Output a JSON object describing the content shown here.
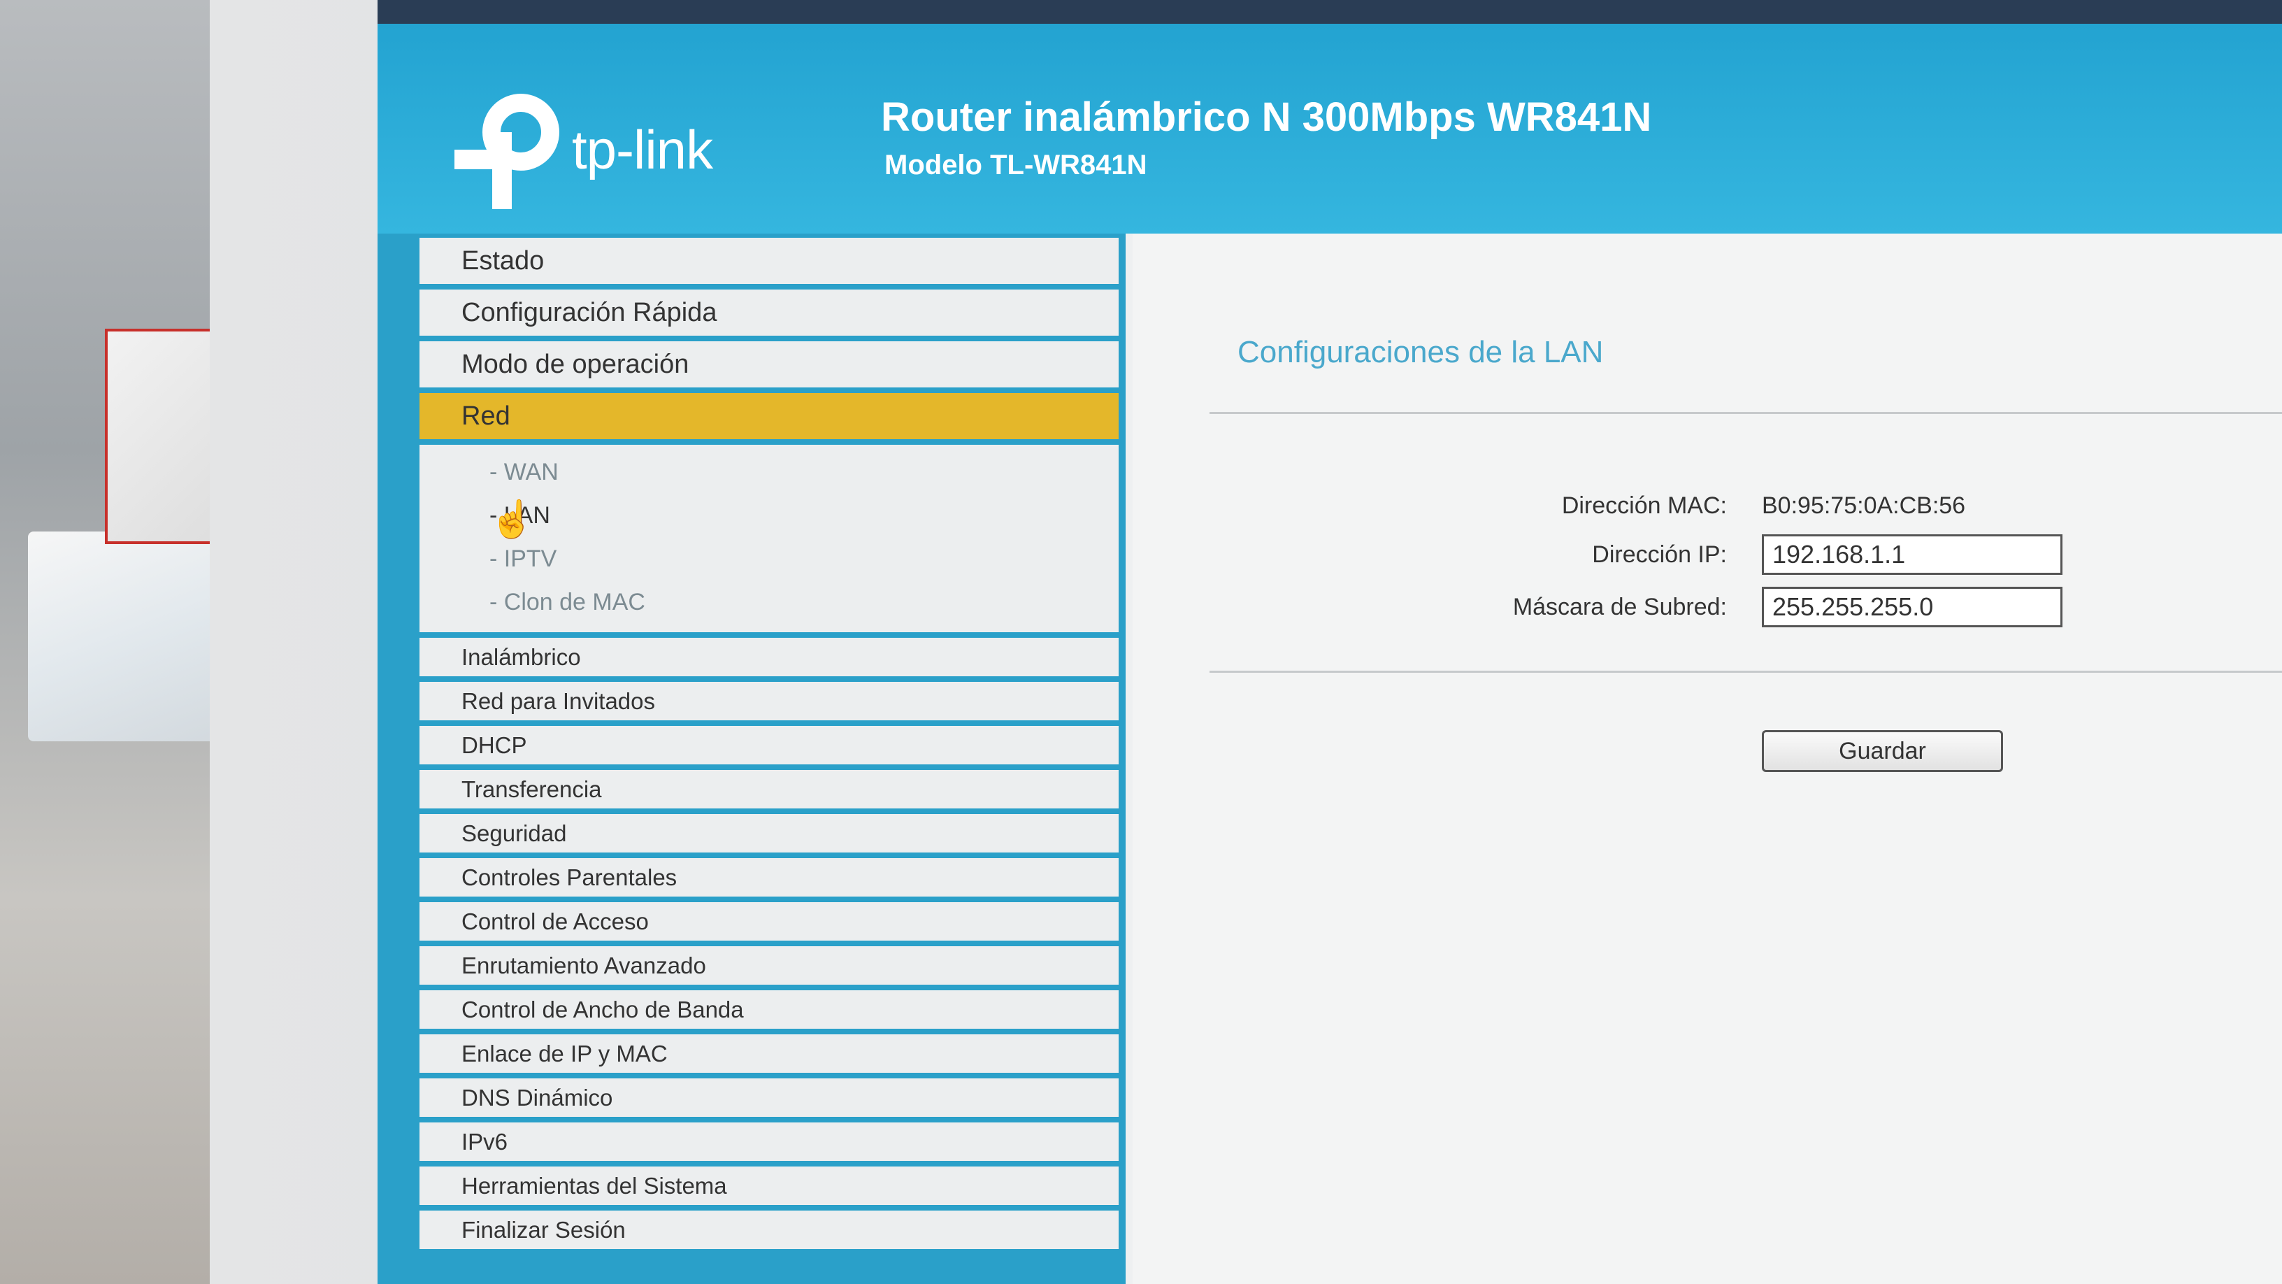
{
  "header": {
    "logo_text": "tp-link",
    "title": "Router inalámbrico N 300Mbps WR841N",
    "model": "Modelo TL-WR841N"
  },
  "sidebar": {
    "items": [
      {
        "label": "Estado"
      },
      {
        "label": "Configuración Rápida"
      },
      {
        "label": "Modo de operación"
      },
      {
        "label": "Red",
        "active": true
      },
      {
        "label": "Inalámbrico"
      },
      {
        "label": "Red para Invitados"
      },
      {
        "label": "DHCP"
      },
      {
        "label": "Transferencia"
      },
      {
        "label": "Seguridad"
      },
      {
        "label": "Controles Parentales"
      },
      {
        "label": "Control de Acceso"
      },
      {
        "label": "Enrutamiento Avanzado"
      },
      {
        "label": "Control de Ancho de Banda"
      },
      {
        "label": "Enlace de IP y MAC"
      },
      {
        "label": "DNS Dinámico"
      },
      {
        "label": "IPv6"
      },
      {
        "label": "Herramientas del Sistema"
      },
      {
        "label": "Finalizar Sesión"
      }
    ],
    "red_submenu": [
      {
        "label": "- WAN"
      },
      {
        "label": "- LAN",
        "current": true
      },
      {
        "label": "- IPTV"
      },
      {
        "label": "- Clon de MAC"
      }
    ]
  },
  "main": {
    "title": "Configuraciones de la LAN",
    "mac_label": "Dirección MAC:",
    "mac_value": "B0:95:75:0A:CB:56",
    "ip_label": "Dirección IP:",
    "ip_value": "192.168.1.1",
    "mask_label": "Máscara de Subred:",
    "mask_value": "255.255.255.0",
    "save_label": "Guardar"
  },
  "colors": {
    "banner": "#23a3d1",
    "active_menu": "#e4b72a",
    "title_text": "#4aa8cc"
  }
}
